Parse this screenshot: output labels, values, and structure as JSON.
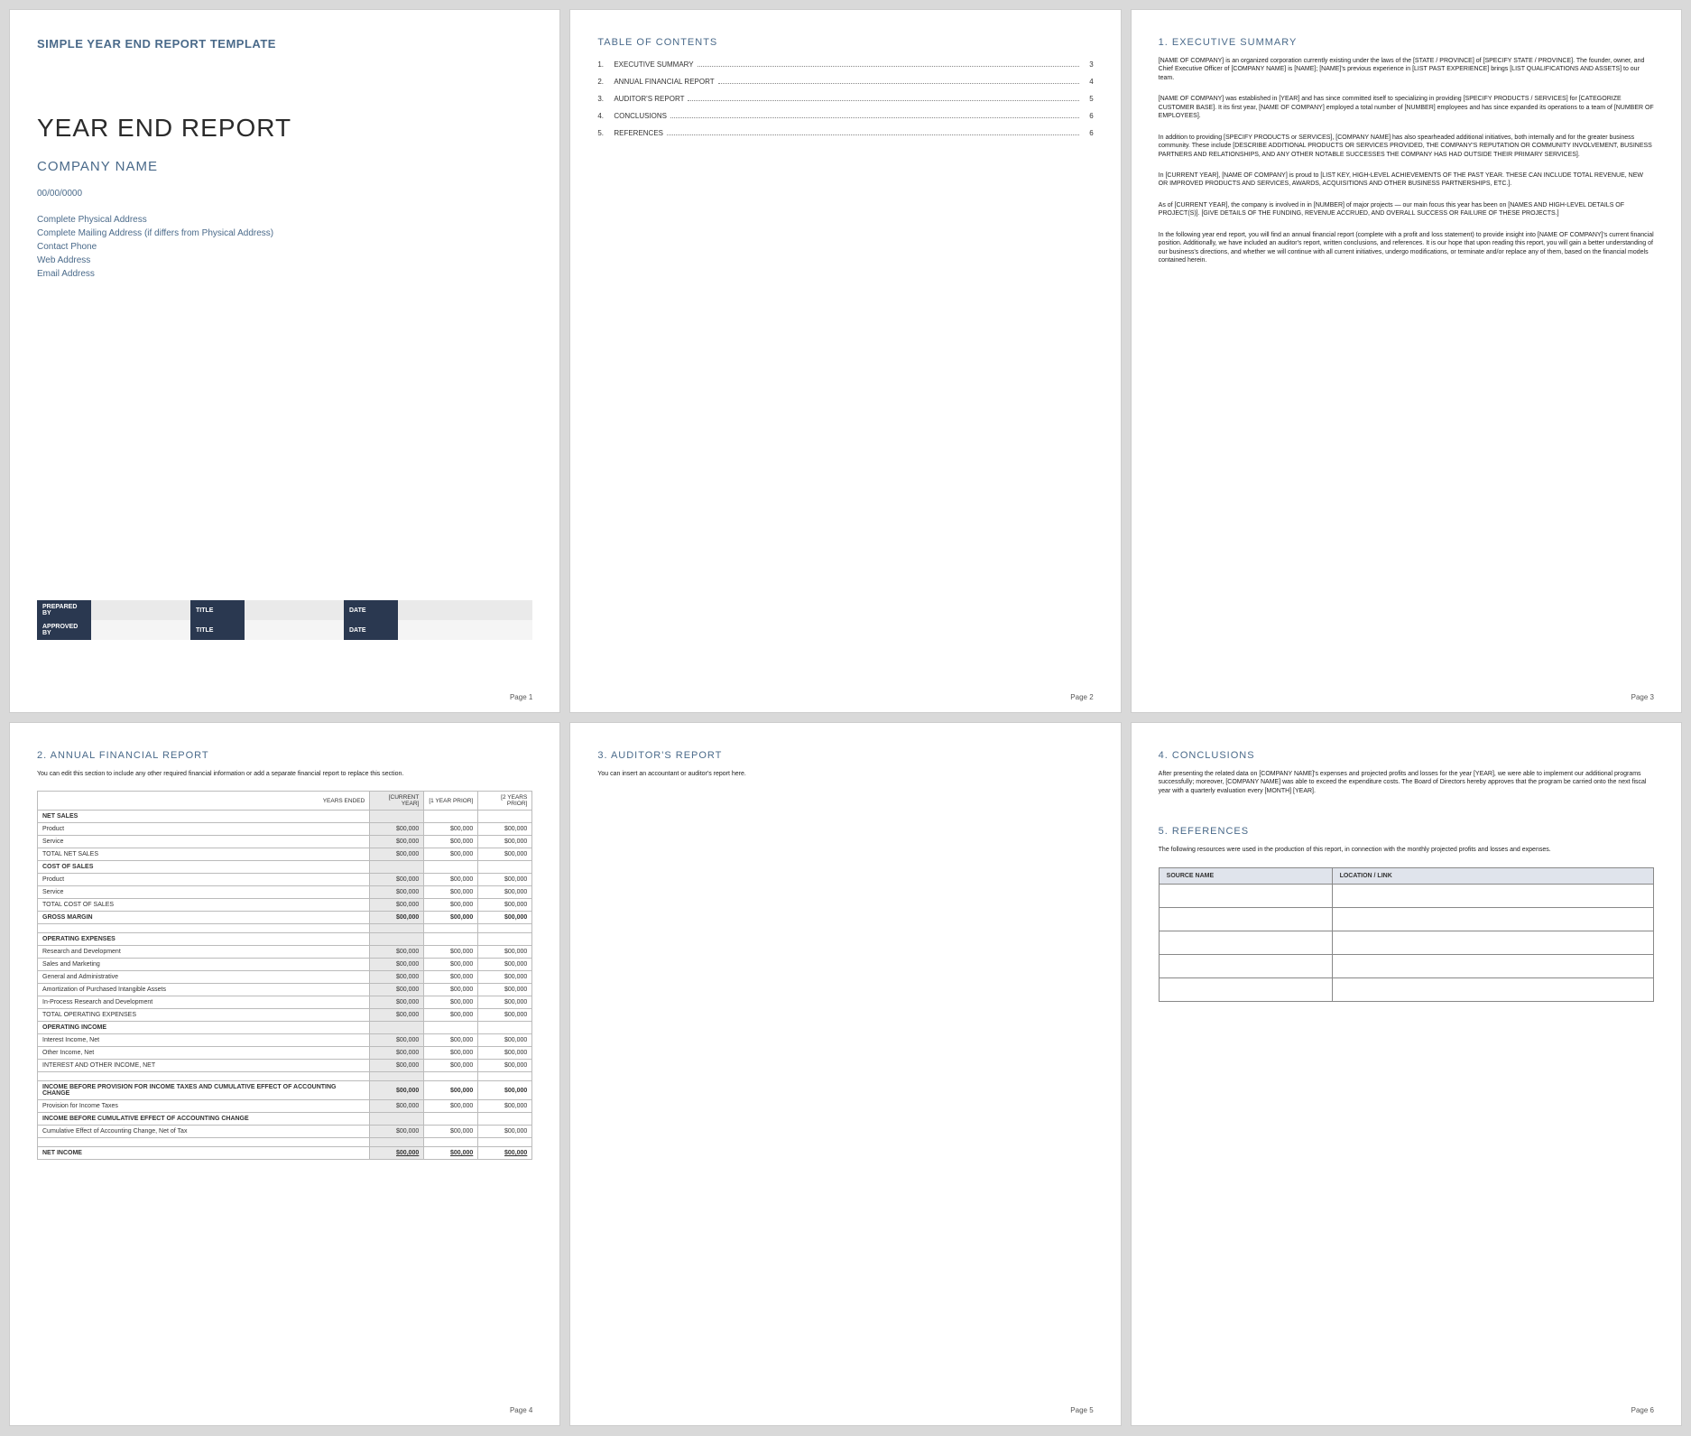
{
  "page1": {
    "template_title": "SIMPLE YEAR END REPORT TEMPLATE",
    "report_title": "YEAR END REPORT",
    "company_name": "COMPANY NAME",
    "date": "00/00/0000",
    "address": {
      "physical": "Complete Physical Address",
      "mailing": "Complete Mailing Address (if differs from Physical Address)",
      "phone": "Contact Phone",
      "web": "Web Address",
      "email": "Email Address"
    },
    "sig": {
      "prepared_by": "PREPARED BY",
      "approved_by": "APPROVED BY",
      "title": "TITLE",
      "date": "DATE"
    },
    "page_num": "Page 1"
  },
  "page2": {
    "heading": "TABLE OF CONTENTS",
    "items": [
      {
        "n": "1.",
        "label": "EXECUTIVE SUMMARY",
        "p": "3"
      },
      {
        "n": "2.",
        "label": "ANNUAL FINANCIAL REPORT",
        "p": "4"
      },
      {
        "n": "3.",
        "label": "AUDITOR'S REPORT",
        "p": "5"
      },
      {
        "n": "4.",
        "label": "CONCLUSIONS",
        "p": "6"
      },
      {
        "n": "5.",
        "label": "REFERENCES",
        "p": "6"
      }
    ],
    "page_num": "Page 2"
  },
  "page3": {
    "heading": "1. EXECUTIVE SUMMARY",
    "p1": "[NAME OF COMPANY] is an organized corporation currently existing under the laws of the [STATE / PROVINCE] of [SPECIFY STATE / PROVINCE]. The founder, owner, and Chief Executive Officer of [COMPANY NAME] is [NAME]; [NAME]'s previous experience in [LIST PAST EXPERIENCE] brings [LIST QUALIFICATIONS AND ASSETS] to our team.",
    "p2": "[NAME OF COMPANY] was established in [YEAR] and has since committed itself to specializing in providing [SPECIFY PRODUCTS / SERVICES] for [CATEGORIZE CUSTOMER BASE]. It its first year, [NAME OF COMPANY] employed a total number of [NUMBER] employees and has since expanded its operations to a team of [NUMBER OF EMPLOYEES].",
    "p3": "In addition to providing [SPECIFY PRODUCTS or SERVICES], [COMPANY NAME] has also spearheaded additional initiatives, both internally and for the greater business community. These include [DESCRIBE ADDITIONAL PRODUCTS OR SERVICES PROVIDED, THE COMPANY'S REPUTATION OR COMMUNITY INVOLVEMENT, BUSINESS PARTNERS AND RELATIONSHIPS, AND ANY OTHER NOTABLE SUCCESSES THE COMPANY HAS HAD OUTSIDE THEIR PRIMARY SERVICES].",
    "p4": "In [CURRENT YEAR], [NAME OF COMPANY] is proud to [LIST KEY, HIGH-LEVEL ACHIEVEMENTS OF THE PAST YEAR. THESE CAN INCLUDE TOTAL REVENUE, NEW OR IMPROVED PRODUCTS AND SERVICES, AWARDS, ACQUISITIONS AND OTHER BUSINESS PARTNERSHIPS, ETC.].",
    "p5": "As of [CURRENT YEAR], the company is involved in in [NUMBER] of major projects — our main focus this year has been on [NAMES AND HIGH-LEVEL DETAILS OF PROJECT(S)]. [GIVE DETAILS OF THE FUNDING, REVENUE ACCRUED, AND OVERALL SUCCESS OR FAILURE OF THESE PROJECTS.]",
    "p6": "In the following year end report, you will find an annual financial report (complete with a profit and loss statement) to provide insight into [NAME OF COMPANY]'s current financial position. Additionally, we have included an auditor's report, written conclusions, and references. It is our hope that upon reading this report, you will gain a better understanding of our business's directions, and whether we will continue with all current initiatives, undergo modifications, or terminate and/or replace any of them, based on the financial models contained herein.",
    "page_num": "Page 3"
  },
  "page4": {
    "heading": "2. ANNUAL FINANCIAL REPORT",
    "intro": "You can edit this section to include any other required financial information or add a separate financial report to replace this section.",
    "cols": {
      "c0": "YEARS ENDED",
      "c1": "[CURRENT YEAR]",
      "c2": "[1 YEAR PRIOR]",
      "c3": "[2 YEARS PRIOR]"
    },
    "val": "$00,000",
    "rows": {
      "net_sales": "NET SALES",
      "product": "Product",
      "service": "Service",
      "total_net_sales": "TOTAL NET SALES",
      "cost_of_sales": "COST OF SALES",
      "total_cost_of_sales": "TOTAL COST OF SALES",
      "gross_margin": "GROSS MARGIN",
      "operating_expenses": "OPERATING EXPENSES",
      "rnd": "Research and Development",
      "sales_mkt": "Sales and Marketing",
      "gen_admin": "General and Administrative",
      "amort": "Amortization of Purchased Intangible Assets",
      "inproc": "In-Process Research and Development",
      "total_opex": "TOTAL OPERATING EXPENSES",
      "op_income": "OPERATING INCOME",
      "interest_inc": "Interest Income, Net",
      "other_inc": "Other Income, Net",
      "int_other": "INTEREST AND OTHER INCOME, NET",
      "ibp": "INCOME BEFORE PROVISION FOR INCOME TAXES AND CUMULATIVE EFFECT OF ACCOUNTING CHANGE",
      "prov_tax": "Provision for Income Taxes",
      "ibc": "INCOME BEFORE CUMULATIVE EFFECT OF ACCOUNTING CHANGE",
      "cum_eff": "Cumulative Effect of Accounting Change, Net of Tax",
      "net_income": "NET INCOME"
    },
    "page_num": "Page 4"
  },
  "page5": {
    "heading": "3. AUDITOR'S REPORT",
    "body": "You can insert an accountant or auditor's report here.",
    "page_num": "Page 5"
  },
  "page6": {
    "conclusions": {
      "heading": "4. CONCLUSIONS",
      "body": "After presenting the related data on [COMPANY NAME]'s expenses and projected profits and losses for the year [YEAR], we were able to implement our additional programs successfully; moreover, [COMPANY NAME] was able to exceed the expenditure costs. The Board of Directors hereby approves that the program be carried onto the next fiscal year with a quarterly evaluation every [MONTH] [YEAR]."
    },
    "references": {
      "heading": "5. REFERENCES",
      "body": "The following resources were used in the production of this report, in connection with the monthly projected profits and losses and expenses.",
      "col1": "SOURCE NAME",
      "col2": "LOCATION / LINK"
    },
    "page_num": "Page 6"
  }
}
